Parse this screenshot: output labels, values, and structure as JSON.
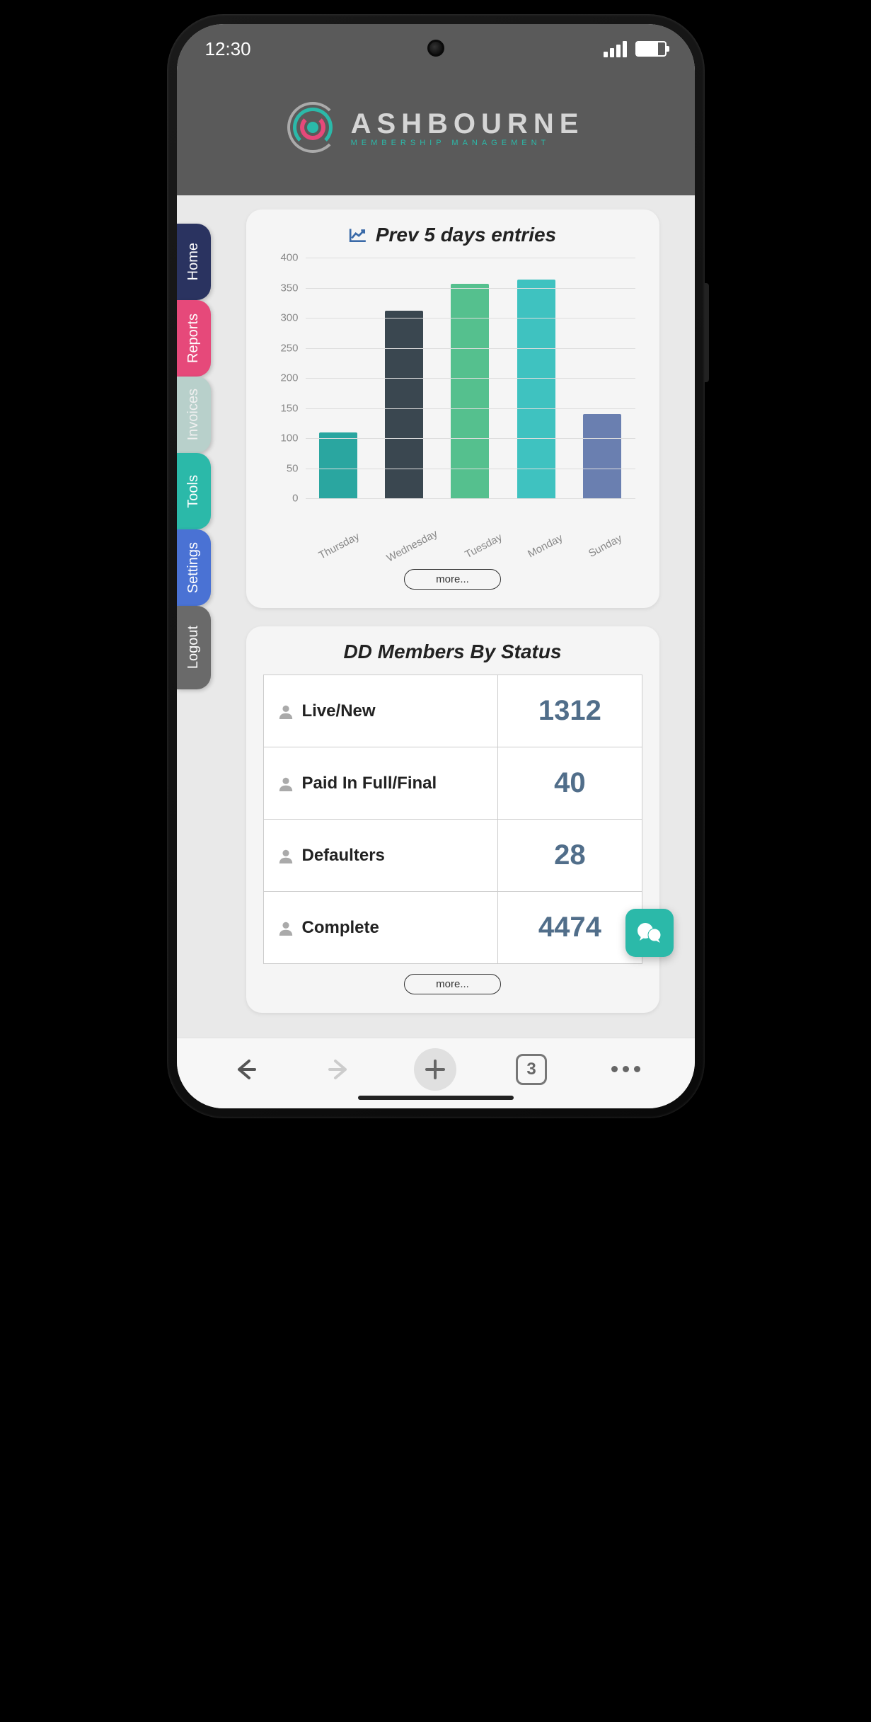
{
  "status_bar": {
    "time": "12:30"
  },
  "brand": {
    "name": "ASHBOURNE",
    "tagline": "MEMBERSHIP MANAGEMENT"
  },
  "sidebar": {
    "items": [
      {
        "label": "Home"
      },
      {
        "label": "Reports"
      },
      {
        "label": "Invoices"
      },
      {
        "label": "Tools"
      },
      {
        "label": "Settings"
      },
      {
        "label": "Logout"
      }
    ]
  },
  "cards": {
    "entries": {
      "title": "Prev 5 days entries",
      "more_label": "more..."
    },
    "dd_status": {
      "title": "DD Members By Status",
      "rows": [
        {
          "label": "Live/New",
          "value": "1312"
        },
        {
          "label": "Paid In Full/Final",
          "value": "40"
        },
        {
          "label": "Defaulters",
          "value": "28"
        },
        {
          "label": "Complete",
          "value": "4474"
        }
      ],
      "more_label": "more..."
    }
  },
  "browser": {
    "tab_count": "3"
  },
  "colors": {
    "bar_thursday": "#2aa6a0",
    "bar_wednesday": "#3a4750",
    "bar_tuesday": "#55c08e",
    "bar_monday": "#3fc2c0",
    "bar_sunday": "#6a7fb0"
  },
  "chart_data": {
    "type": "bar",
    "title": "Prev 5 days entries",
    "categories": [
      "Thursday",
      "Wednesday",
      "Tuesday",
      "Monday",
      "Sunday"
    ],
    "values": [
      110,
      312,
      357,
      363,
      140
    ],
    "xlabel": "",
    "ylabel": "",
    "ylim": [
      0,
      400
    ],
    "yticks": [
      0,
      50,
      100,
      150,
      200,
      250,
      300,
      350,
      400
    ]
  }
}
